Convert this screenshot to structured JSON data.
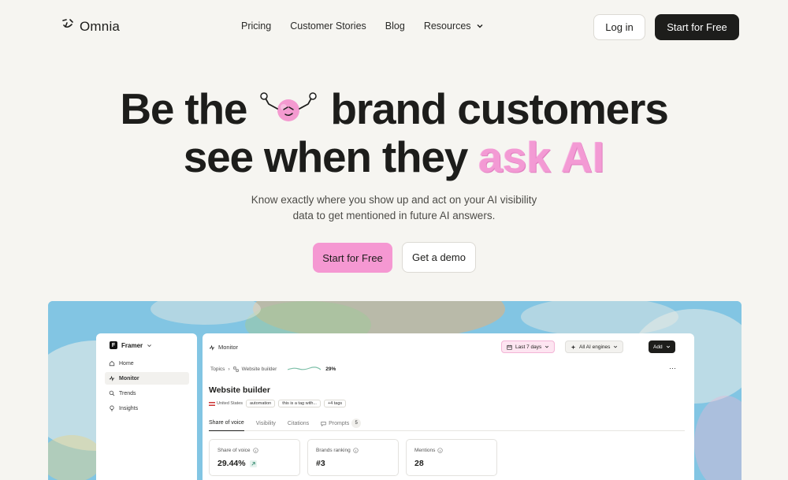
{
  "brand": {
    "name": "Omnia"
  },
  "nav": {
    "links": [
      "Pricing",
      "Customer Stories",
      "Blog",
      "Resources"
    ],
    "login": "Log in",
    "start": "Start for Free"
  },
  "hero": {
    "line1_a": "Be the",
    "line1_b": "brand customers",
    "line2_a": "see when they",
    "line2_b": "ask AI",
    "subtitle_1": "Know exactly where you show up and act on your AI visibility",
    "subtitle_2": "data to get mentioned in future AI answers.",
    "cta_primary": "Start for Free",
    "cta_secondary": "Get a demo"
  },
  "app": {
    "workspace": "Framer",
    "sidebar": [
      {
        "label": "Home",
        "icon": "home-icon"
      },
      {
        "label": "Monitor",
        "icon": "monitor-icon",
        "active": true
      },
      {
        "label": "Trends",
        "icon": "search-icon"
      },
      {
        "label": "Insights",
        "icon": "lightbulb-icon"
      }
    ],
    "header": {
      "title": "Monitor",
      "date_range": "Last 7 days",
      "engines": "All AI engines",
      "add": "Add"
    },
    "breadcrumb": {
      "root": "Topics",
      "current": "Website builder",
      "percent": "29%"
    },
    "page_title": "Website builder",
    "tags": [
      "United States",
      "automation",
      "this is a tag with...",
      "+4 tags"
    ],
    "tabs": [
      {
        "label": "Share of voice",
        "active": true
      },
      {
        "label": "Visibility"
      },
      {
        "label": "Citations"
      },
      {
        "label": "Prompts",
        "count": "5"
      }
    ],
    "cards": [
      {
        "label": "Share of voice",
        "value": "29.44%",
        "trend": "up"
      },
      {
        "label": "Brands ranking",
        "value": "#3"
      },
      {
        "label": "Mentions",
        "value": "28"
      }
    ]
  },
  "colors": {
    "accent_pink": "#f598d2",
    "dark": "#1d1d1b",
    "background": "#f6f5f1",
    "sky": "#7cc3e2"
  }
}
